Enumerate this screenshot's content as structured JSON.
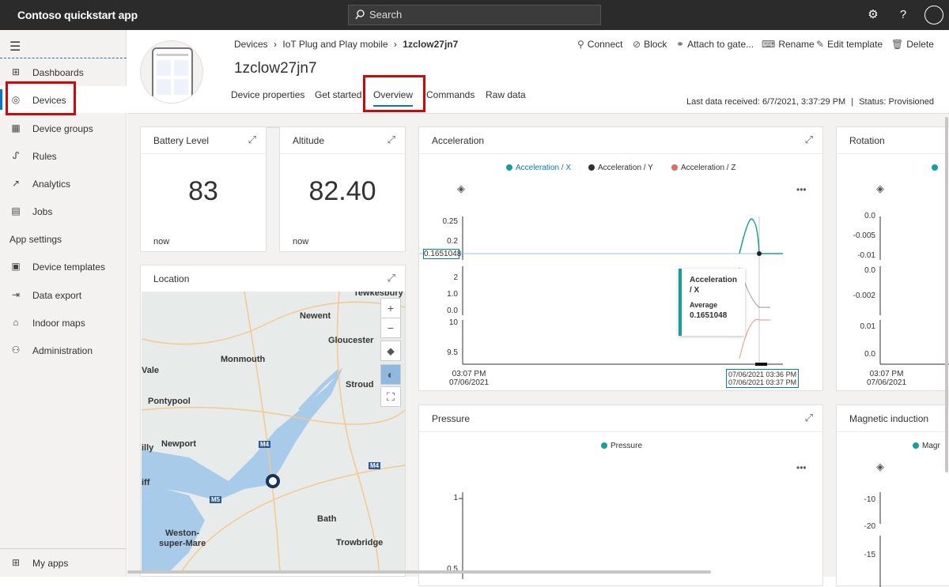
{
  "topbar": {
    "app_title": "Contoso quickstart app",
    "search_placeholder": "Search"
  },
  "sidebar": {
    "items": [
      {
        "label": "Dashboards",
        "icon": "dashboard-icon"
      },
      {
        "label": "Devices",
        "icon": "devices-icon",
        "selected": true
      },
      {
        "label": "Device groups",
        "icon": "device-groups-icon"
      },
      {
        "label": "Rules",
        "icon": "rules-icon"
      },
      {
        "label": "Analytics",
        "icon": "analytics-icon"
      },
      {
        "label": "Jobs",
        "icon": "jobs-icon"
      }
    ],
    "section_title": "App settings",
    "settings_items": [
      {
        "label": "Device templates",
        "icon": "device-templates-icon"
      },
      {
        "label": "Data export",
        "icon": "data-export-icon"
      },
      {
        "label": "Indoor maps",
        "icon": "indoor-maps-icon"
      },
      {
        "label": "Administration",
        "icon": "administration-icon"
      }
    ],
    "my_apps": "My apps"
  },
  "header": {
    "breadcrumb": [
      "Devices",
      "IoT Plug and Play mobile",
      "1zclow27jn7"
    ],
    "device_title": "1zclow27jn7",
    "tabs": [
      "Device properties",
      "Get started",
      "Overview",
      "Commands",
      "Raw data"
    ],
    "actions": [
      "Connect",
      "Block",
      "Attach to gate...",
      "Rename",
      "Edit template",
      "Delete"
    ],
    "last_data": "Last data received: 6/7/2021, 3:37:29 PM",
    "status": "Status: Provisioned"
  },
  "tiles": {
    "battery": {
      "title": "Battery Level",
      "value": "83",
      "sub": "now"
    },
    "altitude": {
      "title": "Altitude",
      "value": "82.40",
      "sub": "now"
    },
    "location": {
      "title": "Location",
      "places": [
        "Tewkesbury",
        "Newent",
        "Gloucester",
        "Monmouth",
        "Stroud",
        "Pontypool",
        "Newport",
        "Bath",
        "Trowbridge",
        "Weston-",
        "super-Mare",
        "Vale",
        "illy",
        "iff"
      ],
      "roads": [
        "M4",
        "M4",
        "M5"
      ]
    },
    "acceleration": {
      "title": "Acceleration",
      "legend": [
        "Acceleration / X",
        "Acceleration / Y",
        "Acceleration / Z"
      ],
      "colors": [
        "#12a295",
        "#323130",
        "#e8675f"
      ],
      "y_ticks_x": [
        "0.25",
        "0.2"
      ],
      "y_ticks_y": [
        "2",
        "1.0",
        "0.0"
      ],
      "y_ticks_z": [
        "10",
        "9.5"
      ],
      "x_ticks": [
        "03:07 PM",
        "07/06/2021"
      ],
      "cursor_value": "0.1651048",
      "range_labels": [
        "07/06/2021 03:36 PM",
        "07/06/2021 03:37 PM"
      ],
      "tooltip": {
        "series": "Acceleration",
        "series2": "/ X",
        "label": "Average",
        "value": "0.1651048"
      }
    },
    "rotation": {
      "title": "Rotation",
      "y_ticks": [
        "0.0",
        "-0.005",
        "-0.01",
        "0.0",
        "-0.002",
        "0.01",
        "0.0"
      ],
      "x_ticks": [
        "03:07 PM",
        "07/06/2021"
      ]
    },
    "pressure": {
      "title": "Pressure",
      "legend": [
        "Pressure"
      ],
      "y_ticks": [
        "1",
        "0.5"
      ]
    },
    "magnetic": {
      "title": "Magnetic induction",
      "legend": [
        "Magr"
      ],
      "y_ticks": [
        "-10",
        "-20",
        "-15"
      ]
    }
  }
}
